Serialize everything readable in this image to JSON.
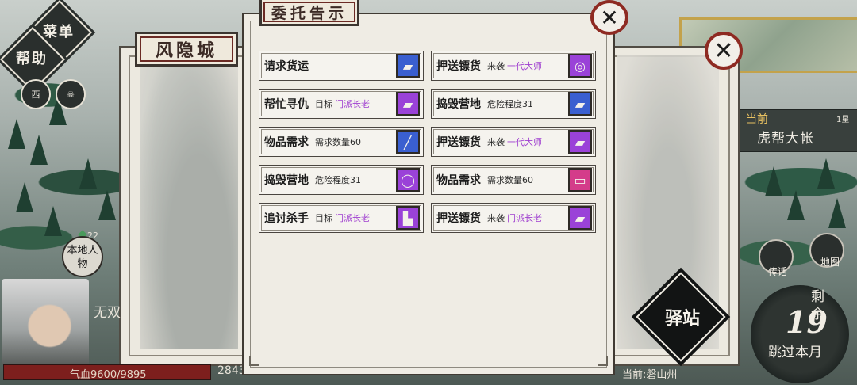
{
  "left_menu": {
    "menu": "菜单",
    "help": "帮助"
  },
  "back_panel": {
    "title": "风隐城"
  },
  "main_panel": {
    "title": "委托告示",
    "quests": [
      {
        "name": "请求货运",
        "detail": "",
        "target": "",
        "icon": "package-icon",
        "icon_color": "blue"
      },
      {
        "name": "押送镖货",
        "detail": "来袭",
        "target": "一代大师",
        "icon": "bracelet-icon",
        "icon_color": "purple"
      },
      {
        "name": "帮忙寻仇",
        "detail": "目标",
        "target": "门派长老",
        "icon": "package-icon",
        "icon_color": "purple"
      },
      {
        "name": "捣毁营地",
        "detail": "危险程度31",
        "target": "",
        "icon": "package-icon",
        "icon_color": "blue"
      },
      {
        "name": "物品需求",
        "detail": "需求数量60",
        "target": "",
        "icon": "spear-icon",
        "icon_color": "blue"
      },
      {
        "name": "押送镖货",
        "detail": "来袭",
        "target": "一代大师",
        "icon": "package-icon",
        "icon_color": "purple"
      },
      {
        "name": "捣毁营地",
        "detail": "危险程度31",
        "target": "",
        "icon": "ring-icon",
        "icon_color": "purple"
      },
      {
        "name": "物品需求",
        "detail": "需求数量60",
        "target": "",
        "icon": "gift-box-icon",
        "icon_color": "pink"
      },
      {
        "name": "追讨杀手",
        "detail": "目标",
        "target": "门派长老",
        "icon": "boot-icon",
        "icon_color": "purple"
      },
      {
        "name": "押送镖货",
        "detail": "来袭",
        "target": "门派长老",
        "icon": "package-icon",
        "icon_color": "purple"
      }
    ]
  },
  "location": {
    "label": "当前",
    "stars": "1星",
    "name": "虎帮大帐"
  },
  "hud": {
    "station": "驿站",
    "remain": "剩余",
    "remain_days": "19",
    "skip_month": "跳过本月",
    "legend": "传话",
    "map": "地图",
    "local_npc": "本地人物",
    "npc_count": "22",
    "hp": "气血9600/9895",
    "money": "2843",
    "current_location": "当前:磐山州",
    "wushuang": "无双"
  },
  "colors": {
    "blue": "#3a5fd0",
    "purple": "#9a42d8",
    "pink": "#d43c8a",
    "target_text": "#a040d0"
  }
}
